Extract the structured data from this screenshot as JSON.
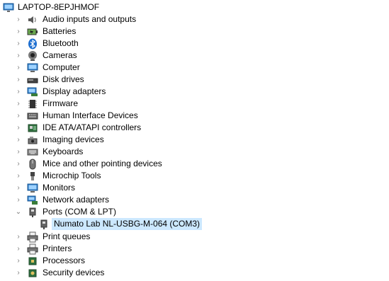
{
  "tree": {
    "root": {
      "label": "LAPTOP-8EPJHMOF",
      "icon": "computer-icon"
    },
    "categories": [
      {
        "label": "Audio inputs and outputs",
        "icon": "speaker-icon",
        "expanded": false
      },
      {
        "label": "Batteries",
        "icon": "battery-icon",
        "expanded": false
      },
      {
        "label": "Bluetooth",
        "icon": "bluetooth-icon",
        "expanded": false
      },
      {
        "label": "Cameras",
        "icon": "camera-icon",
        "expanded": false
      },
      {
        "label": "Computer",
        "icon": "monitor-icon",
        "expanded": false
      },
      {
        "label": "Disk drives",
        "icon": "disk-drive-icon",
        "expanded": false
      },
      {
        "label": "Display adapters",
        "icon": "display-adapter-icon",
        "expanded": false
      },
      {
        "label": "Firmware",
        "icon": "firmware-chip-icon",
        "expanded": false
      },
      {
        "label": "Human Interface Devices",
        "icon": "hid-keyboard-icon",
        "expanded": false
      },
      {
        "label": "IDE ATA/ATAPI controllers",
        "icon": "ide-controller-icon",
        "expanded": false
      },
      {
        "label": "Imaging devices",
        "icon": "imaging-device-icon",
        "expanded": false
      },
      {
        "label": "Keyboards",
        "icon": "keyboard-icon",
        "expanded": false
      },
      {
        "label": "Mice and other pointing devices",
        "icon": "mouse-icon",
        "expanded": false
      },
      {
        "label": "Microchip Tools",
        "icon": "connector-icon",
        "expanded": false
      },
      {
        "label": "Monitors",
        "icon": "monitor-icon",
        "expanded": false
      },
      {
        "label": "Network adapters",
        "icon": "network-adapter-icon",
        "expanded": false
      },
      {
        "label": "Ports (COM & LPT)",
        "icon": "port-icon",
        "expanded": true,
        "children": [
          {
            "label": "Numato Lab NL-USBG-M-064 (COM3)",
            "icon": "port-icon",
            "selected": true
          }
        ]
      },
      {
        "label": "Print queues",
        "icon": "printer-icon",
        "expanded": false
      },
      {
        "label": "Printers",
        "icon": "printer-icon",
        "expanded": false
      },
      {
        "label": "Processors",
        "icon": "processor-icon",
        "expanded": false
      },
      {
        "label": "Security devices",
        "icon": "security-device-icon",
        "expanded": false
      }
    ]
  },
  "colors": {
    "selection": "#cce8ff",
    "chevron": "#7a7a7a",
    "icon_blue": "#2b78c5",
    "icon_gray": "#5a5a5a"
  }
}
